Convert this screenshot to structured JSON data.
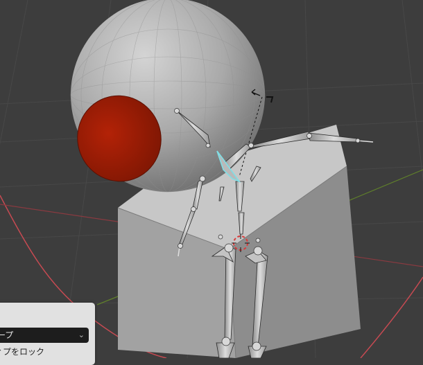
{
  "operator_panel": {
    "select_value": "ープ",
    "lock_label": "ィプをロック",
    "dropdown_icon": "chevron-down-icon"
  },
  "colors": {
    "background": "#3d3d3d",
    "grid_line": "#4a4a4a",
    "x_axis": "#c0424a",
    "y_axis": "#6e8d32",
    "mesh_gray": "#9a9a9a",
    "red_eye": "#a11a05",
    "selected_bone": "#7fdfe6",
    "panel_bg": "#e1e1e1",
    "field_bg": "#1d1d1d"
  }
}
